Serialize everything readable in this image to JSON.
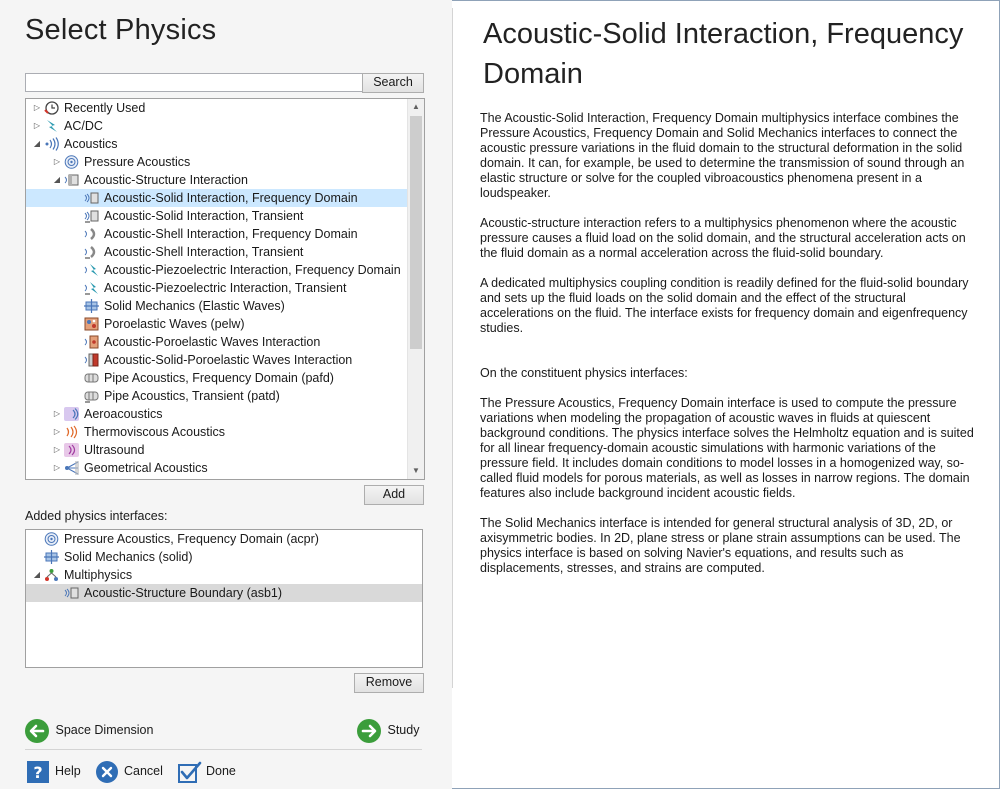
{
  "left_title": "Select Physics",
  "search": {
    "value": "",
    "button": "Search"
  },
  "tree": [
    {
      "label": "Recently Used",
      "icon": "clock-icon",
      "expander": "collapsed"
    },
    {
      "label": "AC/DC",
      "icon": "lightning-icon",
      "expander": "collapsed"
    },
    {
      "label": "Acoustics",
      "icon": "sound-waves-icon",
      "expander": "expanded"
    },
    {
      "label": "Pressure Acoustics",
      "icon": "pressure-acoustics-icon",
      "expander": "collapsed"
    },
    {
      "label": "Acoustic-Structure Interaction",
      "icon": "acoustic-structure-icon",
      "expander": "expanded"
    },
    {
      "label": "Acoustic-Solid Interaction, Frequency Domain",
      "icon": "acoustic-solid-icon",
      "expander": "none"
    },
    {
      "label": "Acoustic-Solid Interaction, Transient",
      "icon": "acoustic-solid-transient-icon",
      "expander": "none"
    },
    {
      "label": "Acoustic-Shell Interaction, Frequency Domain",
      "icon": "acoustic-shell-icon",
      "expander": "none"
    },
    {
      "label": "Acoustic-Shell Interaction, Transient",
      "icon": "acoustic-shell-transient-icon",
      "expander": "none"
    },
    {
      "label": "Acoustic-Piezoelectric Interaction, Frequency Domain",
      "icon": "acoustic-piezo-icon",
      "expander": "none"
    },
    {
      "label": "Acoustic-Piezoelectric Interaction, Transient",
      "icon": "acoustic-piezo-transient-icon",
      "expander": "none"
    },
    {
      "label": "Solid Mechanics (Elastic Waves)",
      "icon": "solid-mechanics-icon",
      "expander": "none"
    },
    {
      "label": "Poroelastic Waves (pelw)",
      "icon": "poroelastic-icon",
      "expander": "none"
    },
    {
      "label": "Acoustic-Poroelastic Waves Interaction",
      "icon": "acoustic-poroelastic-icon",
      "expander": "none"
    },
    {
      "label": "Acoustic-Solid-Poroelastic Waves Interaction",
      "icon": "acoustic-solid-poroelastic-icon",
      "expander": "none"
    },
    {
      "label": "Pipe Acoustics, Frequency Domain (pafd)",
      "icon": "pipe-acoustics-icon",
      "expander": "none"
    },
    {
      "label": "Pipe Acoustics, Transient (patd)",
      "icon": "pipe-acoustics-transient-icon",
      "expander": "none"
    },
    {
      "label": "Aeroacoustics",
      "icon": "aeroacoustics-icon",
      "expander": "collapsed"
    },
    {
      "label": "Thermoviscous Acoustics",
      "icon": "thermoviscous-icon",
      "expander": "collapsed"
    },
    {
      "label": "Ultrasound",
      "icon": "ultrasound-icon",
      "expander": "collapsed"
    },
    {
      "label": "Geometrical Acoustics",
      "icon": "geometrical-acoustics-icon",
      "expander": "collapsed"
    }
  ],
  "add_button": "Add",
  "added_label": "Added physics interfaces:",
  "added": [
    {
      "label": "Pressure Acoustics, Frequency Domain (acpr)",
      "icon": "pressure-acoustics-icon",
      "expander": "none"
    },
    {
      "label": "Solid Mechanics (solid)",
      "icon": "solid-mechanics-icon",
      "expander": "none"
    },
    {
      "label": "Multiphysics",
      "icon": "multiphysics-icon",
      "expander": "expanded"
    },
    {
      "label": "Acoustic-Structure Boundary (asb1)",
      "icon": "acoustic-structure-boundary-icon",
      "expander": "none"
    }
  ],
  "remove_button": "Remove",
  "nav": {
    "back": "Space Dimension",
    "next": "Study"
  },
  "bottom": {
    "help": "Help",
    "cancel": "Cancel",
    "done": "Done"
  },
  "right_title": "Acoustic-Solid Interaction, Frequency Domain",
  "description": [
    "The Acoustic-Solid Interaction, Frequency Domain multiphysics interface combines the Pressure Acoustics, Frequency Domain and Solid Mechanics interfaces to connect the acoustic pressure variations in the fluid domain to the structural deformation in the solid domain. It can, for example, be used to determine the transmission of sound through an elastic structure or solve for the coupled vibroacoustics phenomena present in a loudspeaker.",
    "Acoustic-structure interaction refers to a multiphysics phenomenon where the acoustic pressure causes a fluid load on the solid domain, and the structural acceleration acts on the fluid domain as a normal acceleration across the fluid-solid boundary.",
    "A dedicated multiphysics coupling condition is readily defined for the fluid-solid boundary and sets up the fluid loads on the solid domain and the effect of the structural accelerations on the fluid. The interface exists for frequency domain and eigenfrequency studies.",
    "On the constituent physics interfaces:",
    "The Pressure Acoustics, Frequency Domain interface is used to compute the pressure variations when modeling the propagation of acoustic waves in fluids at quiescent background conditions. The physics interface solves the Helmholtz equation and is suited for all linear frequency-domain acoustic simulations with harmonic variations of the pressure field. It includes domain conditions to model losses in a homogenized way, so-called fluid models for porous materials, as well as losses in narrow regions. The domain features also include background incident acoustic fields.",
    "The Solid Mechanics interface is intended for general structural analysis of 3D, 2D, or axisymmetric bodies. In 2D, plane stress or plane strain assumptions can be used. The physics interface is based on solving Navier's equations, and results such as displacements, stresses, and strains are computed."
  ],
  "colors": {
    "selection": "#cce8ff",
    "selection_inactive": "#d9d9d9",
    "nav_green": "#3b9d3b",
    "help_blue": "#2f6db5"
  }
}
